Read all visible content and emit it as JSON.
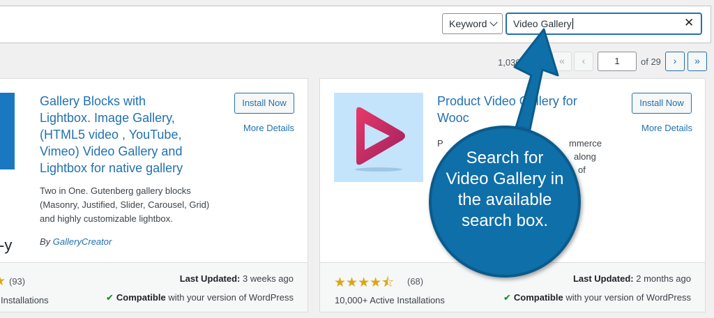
{
  "search": {
    "type_selected": "Keyword",
    "query": "Video Gallery"
  },
  "pagination": {
    "count": "1,036",
    "first": "«",
    "prev": "‹",
    "current_page": "1",
    "of_pages": "of 29",
    "next": "›",
    "last": "»"
  },
  "cards": [
    {
      "title": "Gallery Blocks with Lightbox. Image Gallery, (HTML5 video , YouTube, Vimeo) Video Gallery and Lightbox for native gallery",
      "title_lines": [
        "Gallery Blocks with",
        "Lightbox. Image Gallery,",
        "(HTML5 video , YouTube,",
        "Vimeo) Video Gallery and",
        "Lightbox for native gallery"
      ],
      "description_lines": [
        "Two in One. Gutenberg gallery blocks",
        "(Masonry, Justified, Slider, Carousel, Grid)",
        "and highly customizable lightbox."
      ],
      "author_prefix": "By ",
      "author": "GalleryCreator",
      "install_label": "Install Now",
      "more_details_label": "More Details",
      "rating_count": "(93)",
      "installs": "Installations",
      "last_updated_label": "Last Updated:",
      "last_updated_value": " 3 weeks ago",
      "compatible_label": "Compatible",
      "compatible_rest": " with your version of WordPress",
      "logo_fragment": "-y"
    },
    {
      "title_lines": [
        "Product Video Gallery for",
        "Wooc"
      ],
      "description_fragments": [
        "P",
        "mmerce",
        "along",
        "of"
      ],
      "install_label": "Install Now",
      "more_details_label": "More Details",
      "rating": 4.5,
      "rating_count": "(68)",
      "installs": "10,000+ Active Installations",
      "last_updated_label": "Last Updated:",
      "last_updated_value": " 2 months ago",
      "compatible_label": "Compatible",
      "compatible_rest": " with your version of WordPress"
    }
  ],
  "callout": {
    "text": "Search for Video Gallery in the available search box."
  },
  "colors": {
    "accent": "#2271b1",
    "callout": "#0f6fa8",
    "star": "#dba617",
    "check": "#008a20"
  }
}
